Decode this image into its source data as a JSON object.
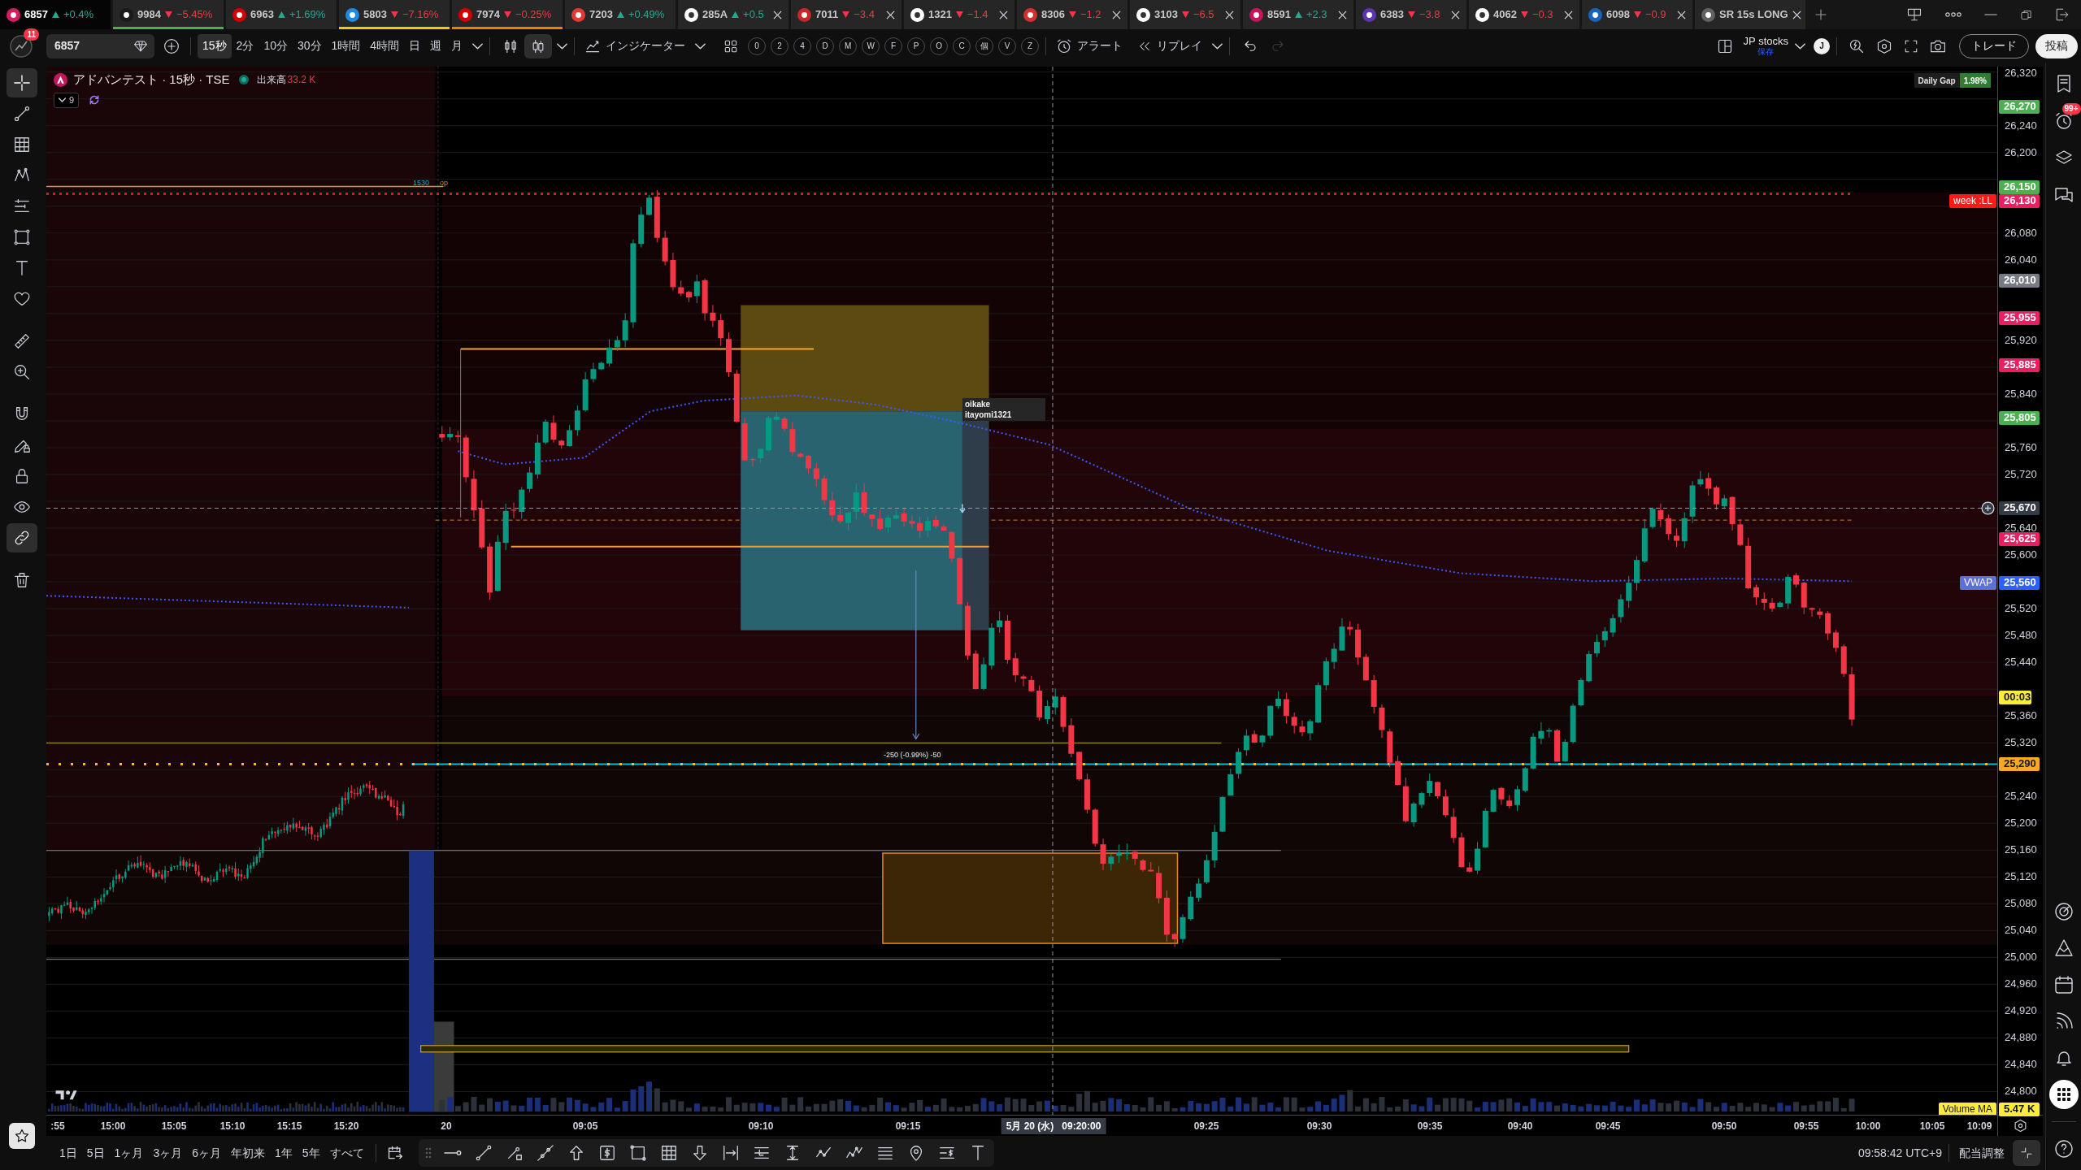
{
  "tabs": [
    {
      "symbol": "6857",
      "change": "+0.4%",
      "rising": true,
      "selected": true,
      "closable": false
    },
    {
      "symbol": "9984",
      "change": "−5.45%",
      "rising": false,
      "selected": false,
      "closable": false,
      "color": "#4caf50"
    },
    {
      "symbol": "6963",
      "change": "+1.69%",
      "rising": true,
      "selected": false,
      "closable": false
    },
    {
      "symbol": "5803",
      "change": "−7.16%",
      "rising": false,
      "selected": false,
      "closable": false,
      "color": "#f5c518"
    },
    {
      "symbol": "7974",
      "change": "−0.25%",
      "rising": false,
      "selected": false,
      "closable": false,
      "color": "#f57c00"
    },
    {
      "symbol": "7203",
      "change": "+0.49%",
      "rising": true,
      "selected": false,
      "closable": false
    },
    {
      "symbol": "285A",
      "change": "+0.5",
      "rising": true,
      "selected": false,
      "closable": true
    },
    {
      "symbol": "7011",
      "change": "−3.4",
      "rising": false,
      "selected": false,
      "closable": true
    },
    {
      "symbol": "1321",
      "change": "−1.4",
      "rising": false,
      "selected": false,
      "closable": true
    },
    {
      "symbol": "8306",
      "change": "−1.2",
      "rising": false,
      "selected": false,
      "closable": true
    },
    {
      "symbol": "3103",
      "change": "−6.5",
      "rising": false,
      "selected": false,
      "closable": true
    },
    {
      "symbol": "8591",
      "change": "+2.3",
      "rising": true,
      "selected": false,
      "closable": true
    },
    {
      "symbol": "6383",
      "change": "−3.8",
      "rising": false,
      "selected": false,
      "closable": true
    },
    {
      "symbol": "4062",
      "change": "−0.3",
      "rising": false,
      "selected": false,
      "closable": true
    },
    {
      "symbol": "6098",
      "change": "−0.9",
      "rising": false,
      "selected": false,
      "closable": true
    },
    {
      "symbol": "SR 15s LONG",
      "selected": false,
      "closable": true
    }
  ],
  "toolbar": {
    "notification_count": "11",
    "symbol": "6857",
    "intervals": [
      {
        "label": "15秒",
        "selected": true
      },
      {
        "label": "2分",
        "selected": false
      },
      {
        "label": "10分",
        "selected": false
      },
      {
        "label": "30分",
        "selected": false
      },
      {
        "label": "1時間",
        "selected": false
      },
      {
        "label": "4時間",
        "selected": false
      },
      {
        "label": "日",
        "selected": false
      },
      {
        "label": "週",
        "selected": false
      },
      {
        "label": "月",
        "selected": false
      }
    ],
    "chart_types": [
      {
        "kind": "candles",
        "selected": false
      },
      {
        "kind": "hollow-candles",
        "selected": true
      }
    ],
    "indicators": "インジケーター",
    "scripts": [
      "0",
      "2",
      "4",
      "D",
      "M",
      "W",
      "F",
      "P",
      "O",
      "C",
      "個",
      "V",
      "Z"
    ],
    "alert": "アラート",
    "replay": "リプレイ",
    "history": [
      {
        "kind": "undo",
        "disabled": false
      },
      {
        "kind": "redo",
        "disabled": true
      }
    ],
    "layout_name": "JP stocks",
    "layout_status": "保存",
    "user_initial": "J",
    "trade": "トレード",
    "publish": "投稿"
  },
  "left_toolbar": {
    "groups": [
      {
        "tools": [
          {
            "kind": "crosshair",
            "selected": true
          },
          {
            "kind": "trend-line",
            "selected": false
          },
          {
            "kind": "fib",
            "selected": false
          },
          {
            "kind": "pattern",
            "selected": false
          },
          {
            "kind": "forecast",
            "selected": false
          },
          {
            "kind": "shapes",
            "selected": false
          },
          {
            "kind": "text",
            "selected": false
          },
          {
            "kind": "favorite",
            "selected": false
          }
        ]
      },
      {
        "tools": [
          {
            "kind": "ruler",
            "selected": false
          },
          {
            "kind": "zoom",
            "selected": false
          }
        ]
      },
      {
        "tools": [
          {
            "kind": "magnet",
            "selected": false
          },
          {
            "kind": "draw-lock",
            "selected": false
          },
          {
            "kind": "lock",
            "selected": false
          },
          {
            "kind": "eye",
            "selected": false
          },
          {
            "kind": "link",
            "selected": true
          }
        ]
      },
      {
        "tools": [
          {
            "kind": "trash",
            "selected": false
          }
        ]
      }
    ],
    "favorites_toggle": {
      "selected": true
    }
  },
  "legend": {
    "title": "アドバンテスト · 15秒 · TSE",
    "market_open": true,
    "volume_label": "出来高",
    "volume": "33.2 K",
    "indicator_count": "9"
  },
  "daily_gap": {
    "label": "Daily Gap",
    "value": "1.98%"
  },
  "drawings": {
    "level_tag": "1530",
    "level_tag_note": "op",
    "note_lines": [
      "oikake",
      "itayomi1321"
    ],
    "measure": "-250 (-0.99%) -50"
  },
  "price_axis": {
    "ticks": [
      "26,320",
      "26,240",
      "26,200",
      "26,080",
      "26,040",
      "25,920",
      "25,840",
      "25,760",
      "25,720",
      "25,640",
      "25,600",
      "25,520",
      "25,480",
      "25,440",
      "25,360",
      "25,320",
      "25,240",
      "25,200",
      "25,160",
      "25,120",
      "25,080",
      "25,040",
      "25,000",
      "24,960",
      "24,920",
      "24,880",
      "24,840",
      "24,800"
    ],
    "badges": [
      {
        "kind": "price",
        "value": "26,270",
        "color": "#4caf50"
      },
      {
        "kind": "price",
        "value": "26,150",
        "color": "#4caf50"
      },
      {
        "kind": "price",
        "value": "26,130",
        "color": "#e91e63",
        "label": {
          "text": "week :LL",
          "color": "#ff1a1a"
        }
      },
      {
        "kind": "price",
        "value": "26,010",
        "color": "#787b86"
      },
      {
        "kind": "price",
        "value": "25,955",
        "color": "#e91e63"
      },
      {
        "kind": "price",
        "value": "25,885",
        "color": "#e91e63"
      },
      {
        "kind": "price",
        "value": "25,805",
        "color": "#4caf50"
      },
      {
        "kind": "crosshair",
        "value": "25,670",
        "color": "#363a45"
      },
      {
        "kind": "price",
        "value": "25,625",
        "color": "#e91e63"
      },
      {
        "kind": "price",
        "value": "25,560",
        "color": "#2962ff",
        "label": {
          "text": "VWAP",
          "color": "#5d6fd8"
        }
      },
      {
        "kind": "countdown",
        "value": "00:03",
        "color": "#ffeb3b"
      },
      {
        "kind": "price",
        "value": "25,290",
        "color": "#f9a825"
      },
      {
        "kind": "price",
        "value": "5.47 K",
        "color": "#ffeb3b",
        "label": {
          "text": "Volume MA",
          "color": "#ffeb3b"
        }
      }
    ]
  },
  "time_axis": {
    "labels": [
      {
        "text": ":55",
        "kind": "tick"
      },
      {
        "text": "15:00",
        "kind": "tick"
      },
      {
        "text": "15:05",
        "kind": "tick"
      },
      {
        "text": "15:10",
        "kind": "tick"
      },
      {
        "text": "15:15",
        "kind": "tick"
      },
      {
        "text": "15:20",
        "kind": "tick"
      },
      {
        "text": "20",
        "kind": "tick"
      },
      {
        "text": "09:05",
        "kind": "tick"
      },
      {
        "text": "09:10",
        "kind": "tick"
      },
      {
        "text": "09:15",
        "kind": "tick"
      },
      {
        "text": "5月 20 (水)   09:20:00",
        "kind": "crosshair"
      },
      {
        "text": "09:25",
        "kind": "tick"
      },
      {
        "text": "09:30",
        "kind": "tick"
      },
      {
        "text": "09:35",
        "kind": "tick"
      },
      {
        "text": "09:40",
        "kind": "tick"
      },
      {
        "text": "09:45",
        "kind": "tick"
      },
      {
        "text": "09:50",
        "kind": "tick"
      },
      {
        "text": "09:55",
        "kind": "tick"
      },
      {
        "text": "10:00",
        "kind": "tick"
      },
      {
        "text": "10:05",
        "kind": "tick"
      },
      {
        "text": "10:09",
        "kind": "tick"
      }
    ]
  },
  "bottom_bar": {
    "ranges": [
      "1日",
      "5日",
      "1ヶ月",
      "3ヶ月",
      "6ヶ月",
      "年初来",
      "1年",
      "5年",
      "すべて"
    ],
    "clock": "09:58:42 UTC+9",
    "adjustment": "配当調整"
  },
  "right_sidebar": {
    "top": [
      {
        "kind": "watchlist",
        "selected": false
      },
      {
        "kind": "alerts",
        "selected": false,
        "badge": "99+"
      },
      {
        "kind": "layers",
        "selected": false
      },
      {
        "kind": "chat",
        "selected": false
      }
    ],
    "bottom": [
      {
        "kind": "radar",
        "selected": false
      },
      {
        "kind": "ideas",
        "selected": false
      },
      {
        "kind": "calendar",
        "selected": false
      },
      {
        "kind": "feed",
        "selected": false
      },
      {
        "kind": "bell",
        "selected": false
      },
      {
        "kind": "apps",
        "selected": true
      },
      {
        "kind": "help",
        "selected": false
      }
    ]
  }
}
